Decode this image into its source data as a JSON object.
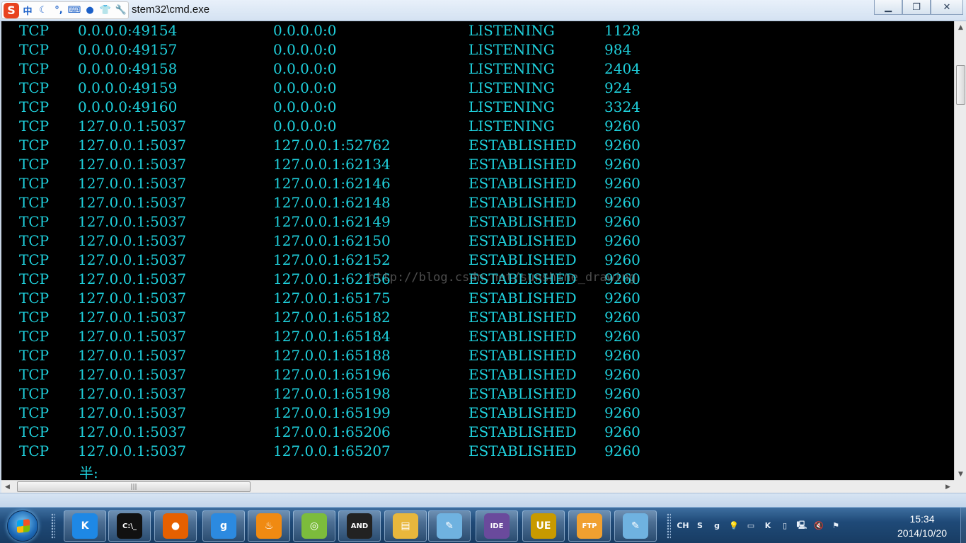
{
  "window": {
    "title": "stem32\\cmd.exe",
    "minimize": "▁",
    "maximize": "❐",
    "close": "✕"
  },
  "ime_toolbar": {
    "logo": "S",
    "items": [
      {
        "icon": "chinese-mode-icon",
        "glyph": "中"
      },
      {
        "icon": "moon-icon",
        "glyph": "☾"
      },
      {
        "icon": "punctuation-icon",
        "glyph": "°,"
      },
      {
        "icon": "keyboard-icon",
        "glyph": "⌨"
      },
      {
        "icon": "user-icon",
        "glyph": "●"
      },
      {
        "icon": "shirt-icon",
        "glyph": "👕"
      },
      {
        "icon": "wrench-icon",
        "glyph": "🔧"
      }
    ]
  },
  "console": {
    "text_color": "#1fd0dc",
    "rows": [
      {
        "proto": "TCP",
        "local": "0.0.0.0:49154",
        "foreign": "0.0.0.0:0",
        "state": "LISTENING",
        "pid": "1128"
      },
      {
        "proto": "TCP",
        "local": "0.0.0.0:49157",
        "foreign": "0.0.0.0:0",
        "state": "LISTENING",
        "pid": "984"
      },
      {
        "proto": "TCP",
        "local": "0.0.0.0:49158",
        "foreign": "0.0.0.0:0",
        "state": "LISTENING",
        "pid": "2404"
      },
      {
        "proto": "TCP",
        "local": "0.0.0.0:49159",
        "foreign": "0.0.0.0:0",
        "state": "LISTENING",
        "pid": "924"
      },
      {
        "proto": "TCP",
        "local": "0.0.0.0:49160",
        "foreign": "0.0.0.0:0",
        "state": "LISTENING",
        "pid": "3324"
      },
      {
        "proto": "TCP",
        "local": "127.0.0.1:5037",
        "foreign": "0.0.0.0:0",
        "state": "LISTENING",
        "pid": "9260"
      },
      {
        "proto": "TCP",
        "local": "127.0.0.1:5037",
        "foreign": "127.0.0.1:52762",
        "state": "ESTABLISHED",
        "pid": "9260"
      },
      {
        "proto": "TCP",
        "local": "127.0.0.1:5037",
        "foreign": "127.0.0.1:62134",
        "state": "ESTABLISHED",
        "pid": "9260"
      },
      {
        "proto": "TCP",
        "local": "127.0.0.1:5037",
        "foreign": "127.0.0.1:62146",
        "state": "ESTABLISHED",
        "pid": "9260"
      },
      {
        "proto": "TCP",
        "local": "127.0.0.1:5037",
        "foreign": "127.0.0.1:62148",
        "state": "ESTABLISHED",
        "pid": "9260"
      },
      {
        "proto": "TCP",
        "local": "127.0.0.1:5037",
        "foreign": "127.0.0.1:62149",
        "state": "ESTABLISHED",
        "pid": "9260"
      },
      {
        "proto": "TCP",
        "local": "127.0.0.1:5037",
        "foreign": "127.0.0.1:62150",
        "state": "ESTABLISHED",
        "pid": "9260"
      },
      {
        "proto": "TCP",
        "local": "127.0.0.1:5037",
        "foreign": "127.0.0.1:62152",
        "state": "ESTABLISHED",
        "pid": "9260"
      },
      {
        "proto": "TCP",
        "local": "127.0.0.1:5037",
        "foreign": "127.0.0.1:62156",
        "state": "ESTABLISHED",
        "pid": "9260"
      },
      {
        "proto": "TCP",
        "local": "127.0.0.1:5037",
        "foreign": "127.0.0.1:65175",
        "state": "ESTABLISHED",
        "pid": "9260"
      },
      {
        "proto": "TCP",
        "local": "127.0.0.1:5037",
        "foreign": "127.0.0.1:65182",
        "state": "ESTABLISHED",
        "pid": "9260"
      },
      {
        "proto": "TCP",
        "local": "127.0.0.1:5037",
        "foreign": "127.0.0.1:65184",
        "state": "ESTABLISHED",
        "pid": "9260"
      },
      {
        "proto": "TCP",
        "local": "127.0.0.1:5037",
        "foreign": "127.0.0.1:65188",
        "state": "ESTABLISHED",
        "pid": "9260"
      },
      {
        "proto": "TCP",
        "local": "127.0.0.1:5037",
        "foreign": "127.0.0.1:65196",
        "state": "ESTABLISHED",
        "pid": "9260"
      },
      {
        "proto": "TCP",
        "local": "127.0.0.1:5037",
        "foreign": "127.0.0.1:65198",
        "state": "ESTABLISHED",
        "pid": "9260"
      },
      {
        "proto": "TCP",
        "local": "127.0.0.1:5037",
        "foreign": "127.0.0.1:65199",
        "state": "ESTABLISHED",
        "pid": "9260"
      },
      {
        "proto": "TCP",
        "local": "127.0.0.1:5037",
        "foreign": "127.0.0.1:65206",
        "state": "ESTABLISHED",
        "pid": "9260"
      },
      {
        "proto": "TCP",
        "local": "127.0.0.1:5037",
        "foreign": "127.0.0.1:65207",
        "state": "ESTABLISHED",
        "pid": "9260"
      }
    ],
    "prompt": "半:",
    "watermark": "http://blog.csdn.net/sunshine_drawing"
  },
  "scrollbars": {
    "up": "▲",
    "down": "▼",
    "left": "◀",
    "right": "▶",
    "grip": "|||"
  },
  "taskbar": {
    "apps": [
      {
        "name": "kuaipan-icon",
        "glyph": "K",
        "color": "#1e88e5"
      },
      {
        "name": "cmd-icon",
        "glyph": "C:\\_",
        "color": "#111111"
      },
      {
        "name": "firefox-icon",
        "glyph": "●",
        "color": "#e66000"
      },
      {
        "name": "ime-app-icon",
        "glyph": "g",
        "color": "#2c8ae0"
      },
      {
        "name": "flame-icon",
        "glyph": "♨",
        "color": "#f08a12"
      },
      {
        "name": "capsule-icon",
        "glyph": "◎",
        "color": "#7cbc3c"
      },
      {
        "name": "android-console-icon",
        "glyph": "AND",
        "color": "#222222"
      },
      {
        "name": "folder-icon",
        "glyph": "▤",
        "color": "#e8b73c"
      },
      {
        "name": "notepad-icon",
        "glyph": "✎",
        "color": "#6fb2e0"
      },
      {
        "name": "java-ee-ide-icon",
        "glyph": "IDE",
        "color": "#6a4a9c"
      },
      {
        "name": "ultraedit-icon",
        "glyph": "UE",
        "color": "#c89a00"
      },
      {
        "name": "ftp-icon",
        "glyph": "FTP",
        "color": "#f0a030"
      },
      {
        "name": "notepad2-icon",
        "glyph": "✎",
        "color": "#6fb2e0"
      }
    ],
    "tray": [
      {
        "name": "language-indicator",
        "glyph": "CH"
      },
      {
        "name": "sogou-tray-icon",
        "glyph": "S"
      },
      {
        "name": "qq-tray-icon",
        "glyph": "g"
      },
      {
        "name": "bulb-tray-icon",
        "glyph": "💡"
      },
      {
        "name": "window-tray-icon",
        "glyph": "▭"
      },
      {
        "name": "kuaipan-tray-icon",
        "glyph": "K"
      },
      {
        "name": "device-tray-icon",
        "glyph": "▯"
      },
      {
        "name": "network-tray-icon",
        "glyph": "🖳"
      },
      {
        "name": "volume-muted-tray-icon",
        "glyph": "🔇"
      },
      {
        "name": "action-center-tray-icon",
        "glyph": "⚑"
      }
    ],
    "clock_time": "15:34",
    "clock_date": "2014/10/20"
  }
}
